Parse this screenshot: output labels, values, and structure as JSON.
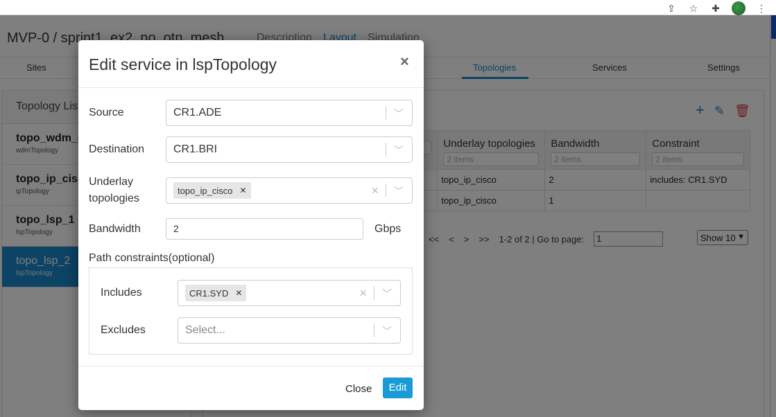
{
  "browser": {
    "icons": [
      "share-icon",
      "star-icon",
      "extensions-icon",
      "profile-avatar",
      "menu-dots-icon"
    ]
  },
  "app": {
    "title": "MVP-0 / sprint1_ex2_no_otn_mesh",
    "header_tabs": [
      {
        "label": "Description",
        "active": false
      },
      {
        "label": "Layout",
        "active": true
      },
      {
        "label": "Simulation",
        "active": false
      }
    ],
    "nav_tabs": [
      {
        "label": "Sites",
        "active": false
      },
      {
        "label": "Topologies",
        "active": true
      },
      {
        "label": "Services",
        "active": false
      },
      {
        "label": "Settings",
        "active": false
      }
    ]
  },
  "topology_list": {
    "heading": "Topology List",
    "items": [
      {
        "name": "topo_wdm_c",
        "type": "wdmTopology",
        "active": false
      },
      {
        "name": "topo_ip_cisco",
        "type": "ipTopology",
        "active": false
      },
      {
        "name": "topo_lsp_1",
        "type": "lspTopology",
        "active": false
      },
      {
        "name": "topo_lsp_2",
        "type": "lspTopology",
        "active": true
      }
    ]
  },
  "services_table": {
    "columns": [
      {
        "label": "",
        "filter": "2 items"
      },
      {
        "label": "Underlay topologies",
        "filter": "2 items"
      },
      {
        "label": "Bandwidth",
        "filter": "2 items"
      },
      {
        "label": "Constraint",
        "filter": "2 items"
      }
    ],
    "rows": [
      [
        "",
        "topo_ip_cisco",
        "2",
        "includes: CR1.SYD"
      ],
      [
        "",
        "topo_ip_cisco",
        "1",
        ""
      ]
    ],
    "pager": {
      "first": "<<",
      "prev": "<",
      "next": ">",
      "last": ">>",
      "summary": "1-2 of 2 | Go to page:",
      "page": "1",
      "show": "Show 10"
    }
  },
  "modal": {
    "title": "Edit service in lspTopology",
    "close_glyph": "×",
    "fields": {
      "source": {
        "label": "Source",
        "value": "CR1.ADE"
      },
      "destination": {
        "label": "Destination",
        "value": "CR1.BRI"
      },
      "underlay": {
        "label": "Underlay topologies",
        "chip": "topo_ip_cisco"
      },
      "bandwidth": {
        "label": "Bandwidth",
        "value": "2",
        "unit": "Gbps"
      }
    },
    "path_constraints": {
      "label": "Path constraints(optional)",
      "includes": {
        "label": "Includes",
        "chip": "CR1.SYD"
      },
      "excludes": {
        "label": "Excludes",
        "placeholder": "Select..."
      }
    },
    "footer": {
      "close_label": "Close",
      "edit_label": "Edit"
    }
  }
}
